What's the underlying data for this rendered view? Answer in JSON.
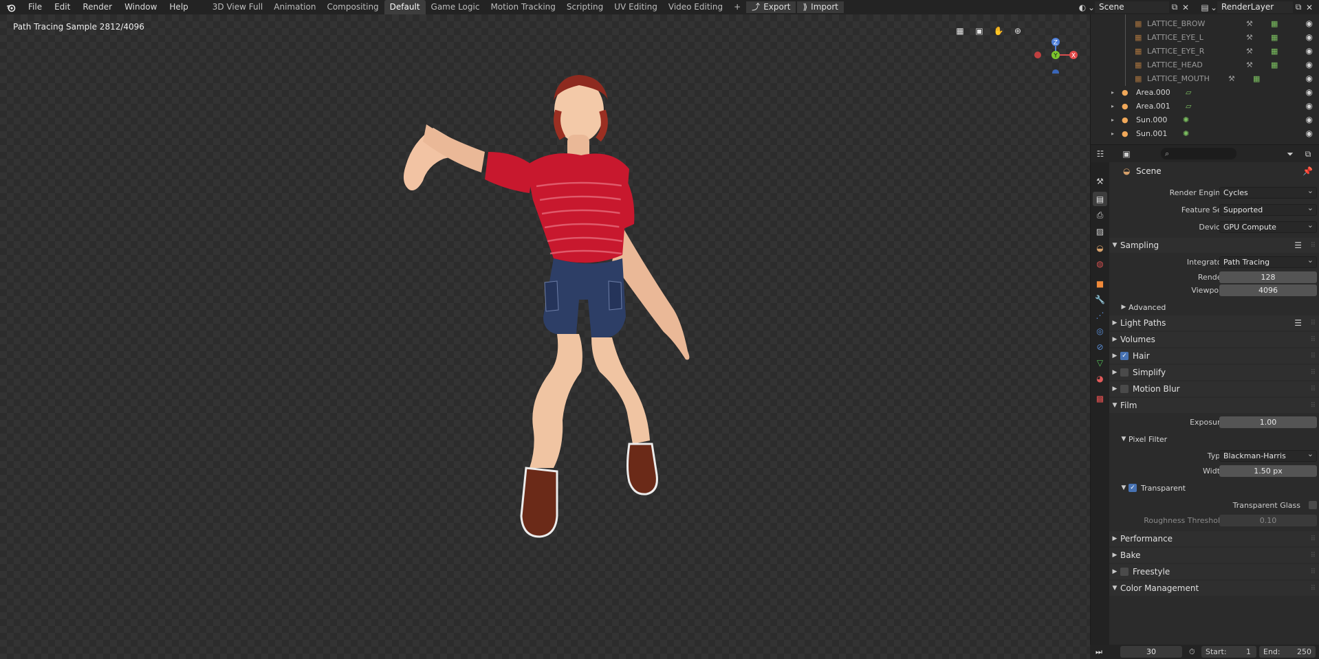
{
  "menu": {
    "file": "File",
    "edit": "Edit",
    "render": "Render",
    "window": "Window",
    "help": "Help"
  },
  "workspaces": [
    {
      "label": "3D View Full",
      "active": false
    },
    {
      "label": "Animation",
      "active": false
    },
    {
      "label": "Compositing",
      "active": false
    },
    {
      "label": "Default",
      "active": true
    },
    {
      "label": "Game Logic",
      "active": false
    },
    {
      "label": "Motion Tracking",
      "active": false
    },
    {
      "label": "Scripting",
      "active": false
    },
    {
      "label": "UV Editing",
      "active": false
    },
    {
      "label": "Video Editing",
      "active": false
    }
  ],
  "header_buttons": {
    "add": "+",
    "export": "Export",
    "import": "Import"
  },
  "scene": {
    "name": "Scene",
    "view_layer": "RenderLayer"
  },
  "viewport": {
    "render_status": "Path Tracing Sample 2812/4096"
  },
  "gizmo": {
    "z": "Z",
    "y": "Y",
    "x": "X"
  },
  "outliner": {
    "rows": [
      {
        "label": "LATTICE_BROW",
        "dim": true
      },
      {
        "label": "LATTICE_EYE_L",
        "dim": true
      },
      {
        "label": "LATTICE_EYE_R",
        "dim": true
      },
      {
        "label": "LATTICE_HEAD",
        "dim": true
      },
      {
        "label": "LATTICE_MOUTH",
        "dim": true
      },
      {
        "label": "Area.000",
        "dim": false
      },
      {
        "label": "Area.001",
        "dim": false
      },
      {
        "label": "Sun.000",
        "dim": false
      },
      {
        "label": "Sun.001",
        "dim": false
      }
    ]
  },
  "properties": {
    "context": "Scene",
    "render_engine": {
      "label": "Render Engine",
      "value": "Cycles"
    },
    "feature_set": {
      "label": "Feature Set",
      "value": "Supported"
    },
    "device": {
      "label": "Device",
      "value": "GPU Compute"
    },
    "sampling": {
      "title": "Sampling",
      "integrator": {
        "label": "Integrator",
        "value": "Path Tracing"
      },
      "render": {
        "label": "Render",
        "value": "128"
      },
      "viewport": {
        "label": "Viewport",
        "value": "4096"
      },
      "advanced": "Advanced"
    },
    "light_paths": "Light Paths",
    "volumes": "Volumes",
    "hair": {
      "label": "Hair",
      "checked": true
    },
    "simplify": {
      "label": "Simplify",
      "checked": false
    },
    "motion_blur": {
      "label": "Motion Blur",
      "checked": false
    },
    "film": {
      "title": "Film",
      "exposure": {
        "label": "Exposure",
        "value": "1.00"
      },
      "pixel_filter": "Pixel Filter",
      "type": {
        "label": "Type",
        "value": "Blackman-Harris"
      },
      "width": {
        "label": "Width",
        "value": "1.50 px"
      },
      "transparent": "Transparent",
      "transparent_glass": "Transparent Glass",
      "roughness_threshold": {
        "label": "Roughness Threshold",
        "value": "0.10"
      }
    },
    "performance": "Performance",
    "bake": "Bake",
    "freestyle": "Freestyle",
    "color_management": "Color Management"
  },
  "timeline": {
    "current_frame": "30",
    "start_label": "Start:",
    "start": "1",
    "end_label": "End:",
    "end": "250"
  }
}
